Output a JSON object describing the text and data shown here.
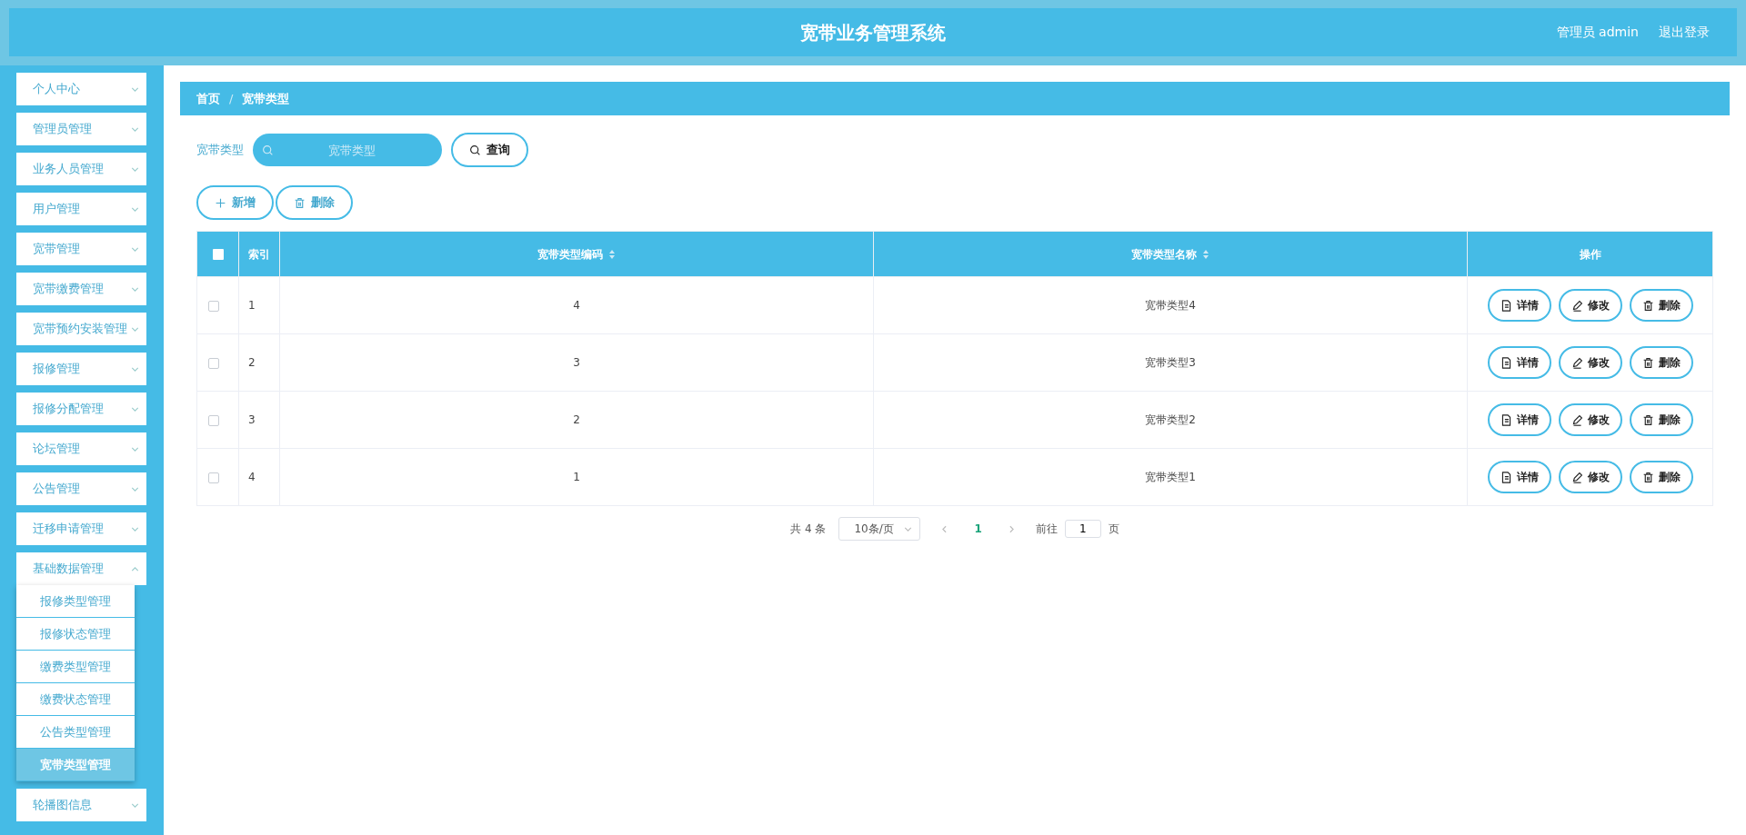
{
  "header": {
    "title": "宽带业务管理系统",
    "user": "管理员 admin",
    "logout": "退出登录"
  },
  "sidebar": {
    "items": [
      {
        "label": "个人中心",
        "expanded": false
      },
      {
        "label": "管理员管理",
        "expanded": false
      },
      {
        "label": "业务人员管理",
        "expanded": false
      },
      {
        "label": "用户管理",
        "expanded": false
      },
      {
        "label": "宽带管理",
        "expanded": false
      },
      {
        "label": "宽带缴费管理",
        "expanded": false
      },
      {
        "label": "宽带预约安装管理",
        "expanded": false
      },
      {
        "label": "报修管理",
        "expanded": false
      },
      {
        "label": "报修分配管理",
        "expanded": false
      },
      {
        "label": "论坛管理",
        "expanded": false
      },
      {
        "label": "公告管理",
        "expanded": false
      },
      {
        "label": "迁移申请管理",
        "expanded": false
      },
      {
        "label": "基础数据管理",
        "expanded": true,
        "children": [
          {
            "label": "报修类型管理",
            "selected": false
          },
          {
            "label": "报修状态管理",
            "selected": false
          },
          {
            "label": "缴费类型管理",
            "selected": false
          },
          {
            "label": "缴费状态管理",
            "selected": false
          },
          {
            "label": "公告类型管理",
            "selected": false
          },
          {
            "label": "宽带类型管理",
            "selected": true
          }
        ]
      },
      {
        "label": "轮播图信息",
        "expanded": false
      }
    ]
  },
  "breadcrumb": {
    "items": [
      "首页",
      "宽带类型"
    ],
    "separator": "/"
  },
  "search": {
    "label": "宽带类型",
    "placeholder": "宽带类型",
    "button": "查询"
  },
  "actions": [
    {
      "label": "新增",
      "kind": "add"
    },
    {
      "label": "删除",
      "kind": "delete"
    }
  ],
  "table": {
    "select_all": false,
    "columns": [
      {
        "label": "索引",
        "sortable": false
      },
      {
        "label": "宽带类型编码",
        "sortable": true
      },
      {
        "label": "宽带类型名称",
        "sortable": true
      },
      {
        "label": "操作",
        "sortable": false
      }
    ],
    "rows": [
      {
        "checked": false,
        "index": "1",
        "code": "4",
        "name": "宽带类型4",
        "actions": [
          {
            "label": "详情",
            "kind": "detail"
          },
          {
            "label": "修改",
            "kind": "edit"
          },
          {
            "label": "删除",
            "kind": "delete"
          }
        ]
      },
      {
        "checked": false,
        "index": "2",
        "code": "3",
        "name": "宽带类型3",
        "actions": [
          {
            "label": "详情",
            "kind": "detail"
          },
          {
            "label": "修改",
            "kind": "edit"
          },
          {
            "label": "删除",
            "kind": "delete"
          }
        ]
      },
      {
        "checked": false,
        "index": "3",
        "code": "2",
        "name": "宽带类型2",
        "actions": [
          {
            "label": "详情",
            "kind": "detail"
          },
          {
            "label": "修改",
            "kind": "edit"
          },
          {
            "label": "删除",
            "kind": "delete"
          }
        ]
      },
      {
        "checked": false,
        "index": "4",
        "code": "1",
        "name": "宽带类型1",
        "actions": [
          {
            "label": "详情",
            "kind": "detail"
          },
          {
            "label": "修改",
            "kind": "edit"
          },
          {
            "label": "删除",
            "kind": "delete"
          }
        ]
      }
    ]
  },
  "pagination": {
    "total": "共 4 条",
    "page_size": "10条/页",
    "pages": [
      {
        "label": "1",
        "selected": true
      }
    ],
    "goto_label": "前往",
    "goto_value": "1",
    "goto_suffix": "页"
  }
}
